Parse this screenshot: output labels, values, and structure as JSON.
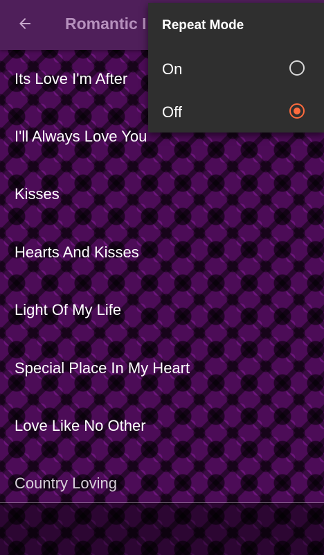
{
  "app_bar": {
    "title": "Romantic I",
    "back_icon": "arrow-left-icon"
  },
  "songs": [
    {
      "title": "Its Love I'm After"
    },
    {
      "title": "I'll Always Love You"
    },
    {
      "title": "Kisses"
    },
    {
      "title": "Hearts And Kisses"
    },
    {
      "title": "Light Of My Life"
    },
    {
      "title": "Special Place In My Heart"
    },
    {
      "title": "Love Like No Other"
    },
    {
      "title": "Country Loving"
    }
  ],
  "repeat_menu": {
    "header": "Repeat Mode",
    "options": [
      {
        "label": "On",
        "selected": false
      },
      {
        "label": "Off",
        "selected": true
      }
    ]
  },
  "colors": {
    "app_bar": "#4f1f5a",
    "title": "#b690bd",
    "accent": "#ff6b3d",
    "menu_background": "#2f2f2f",
    "list_text": "#ffffff"
  }
}
